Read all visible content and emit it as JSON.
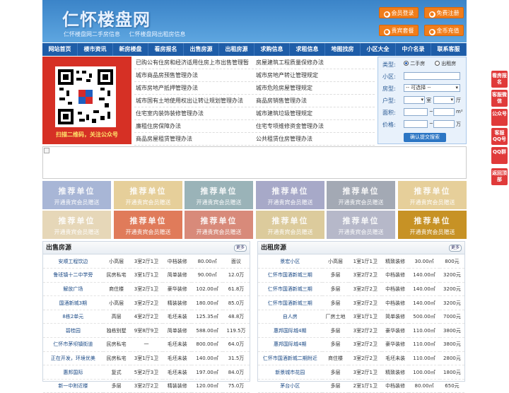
{
  "header": {
    "site_title": "仁怀楼盘网",
    "sub_links": [
      "仁怀楼盘网二手房信息",
      "仁怀楼盘网出租房信息"
    ],
    "buttons": [
      "会员登录",
      "免费注册",
      "贵宾套餐",
      "金币充值"
    ]
  },
  "nav": [
    "网站首页",
    "楼市资讯",
    "新房楼盘",
    "看房报名",
    "出售房源",
    "出租房源",
    "求购信息",
    "求租信息",
    "地图找房",
    "小区大全",
    "中介名录",
    "联系客服"
  ],
  "qr_caption": "扫描二维码，关注公众号",
  "links": [
    [
      "已购公有住房和经济适用住房上市出售管理暂",
      "房屋建筑工程质量保修办法"
    ],
    [
      "城市商品房预售管理办法",
      "城市房地产转让管理规定"
    ],
    [
      "城市房地产抵押管理办法",
      "城市危险房屋管理规定"
    ],
    [
      "城市国有土地使用权出让转让规划管理办法",
      "商品房销售管理办法"
    ],
    [
      "住宅室内装饰装修管理办法",
      "城市建筑垃圾管理规定"
    ],
    [
      "廉租住房保障办法",
      "住宅专项维修资金管理办法"
    ],
    [
      "商品房屋租赁管理办法",
      "公共租赁住房管理办法"
    ]
  ],
  "search": {
    "type_label": "类型:",
    "type_options": [
      "二手房",
      "出租房"
    ],
    "community_label": "小区:",
    "housetype_label": "房型:",
    "housetype_value": "-- 可选择 --",
    "layout_label": "户型:",
    "room_unit": "室",
    "hall_unit": "厅",
    "area_label": "面积:",
    "area_unit": "m²",
    "price_label": "价格:",
    "price_unit": "万",
    "tilde": "~",
    "submit": "确认提交搜索"
  },
  "ads": {
    "title": "推荐单位",
    "subtitle": "开通贵宾会员赠送",
    "colors": [
      "#a8b6d6",
      "#e6cf9a",
      "#9ab3b8",
      "#a7a9c8",
      "#a3a9b4",
      "#e6cf9a",
      "#e6d7b8",
      "#e07b5a",
      "#d88a7a",
      "#dccb9c",
      "#b6b8c9",
      "#c79225"
    ]
  },
  "sale": {
    "title": "出售房源",
    "more": "更多",
    "rows": [
      [
        "安顺工程饮边",
        "小高层",
        "3室2厅1卫",
        "中档装修",
        "80.00㎡",
        "面议"
      ],
      [
        "鲁班镇十二中学旁",
        "民房私宅",
        "3室1厅1卫",
        "简单装修",
        "90.00㎡",
        "12.0万"
      ],
      [
        "解放广场",
        "商住楼",
        "3室2厅1卫",
        "豪华装修",
        "102.00㎡",
        "61.8万"
      ],
      [
        "国酒新城3期",
        "小高层",
        "3室2厅2卫",
        "精装装修",
        "180.00㎡",
        "85.0万"
      ],
      [
        "8栋2单元",
        "高层",
        "4室2厅2卫",
        "毛坯未装",
        "125.35㎡",
        "48.8万"
      ],
      [
        "碧桂园",
        "独栋别墅",
        "9室8厅9卫",
        "简单装修",
        "588.00㎡",
        "119.5万"
      ],
      [
        "仁怀市茅坝镇街道",
        "民房私宅",
        "一",
        "毛坯未装",
        "800.00㎡",
        "64.0万"
      ],
      [
        "正在开发，环境优美",
        "民房私宅",
        "3室1厅1卫",
        "毛坯未装",
        "140.00㎡",
        "31.5万"
      ],
      [
        "惠邦国际",
        "复式",
        "5室2厅3卫",
        "毛坯未装",
        "197.00㎡",
        "84.0万"
      ],
      [
        "新一中附近楼",
        "多层",
        "3室2厅2卫",
        "精装装修",
        "120.00㎡",
        "75.0万"
      ]
    ]
  },
  "rent": {
    "title": "出租房源",
    "more": "更多",
    "rows": [
      [
        "景宏小区",
        "小高层",
        "1室1厅1卫",
        "精致装修",
        "30.00㎡",
        "800元"
      ],
      [
        "仁怀市国酒新城三期",
        "多层",
        "3室2厅2卫",
        "中档装修",
        "140.00㎡",
        "3200元"
      ],
      [
        "仁怀市国酒新城三期",
        "多层",
        "3室2厅2卫",
        "中档装修",
        "140.00㎡",
        "3200元"
      ],
      [
        "仁怀市国酒新城三期",
        "多层",
        "3室2厅2卫",
        "中档装修",
        "140.00㎡",
        "3200元"
      ],
      [
        "自人房",
        "厂房土地",
        "3室1厅1卫",
        "简单装修",
        "500.00㎡",
        "7000元"
      ],
      [
        "惠邦国际城4期",
        "多层",
        "3室2厅2卫",
        "豪华装修",
        "110.00㎡",
        "3800元"
      ],
      [
        "惠邦国际城4期",
        "多层",
        "3室2厅2卫",
        "豪华装修",
        "110.00㎡",
        "3800元"
      ],
      [
        "仁怀市国酒新城二期附近",
        "商住楼",
        "3室2厅2卫",
        "毛坯未装",
        "110.00㎡",
        "2800元"
      ],
      [
        "新景城市花园",
        "多层",
        "3室2厅1卫",
        "精致装修",
        "100.00㎡",
        "1800元"
      ],
      [
        "茅台小区",
        "多层",
        "2室1厅1卫",
        "中档装修",
        "80.00㎡",
        "650元"
      ]
    ]
  },
  "side_tabs": [
    "看房报名",
    "客服微信",
    "公众号",
    "客服QQ号",
    "QQ群",
    "返回顶部"
  ]
}
